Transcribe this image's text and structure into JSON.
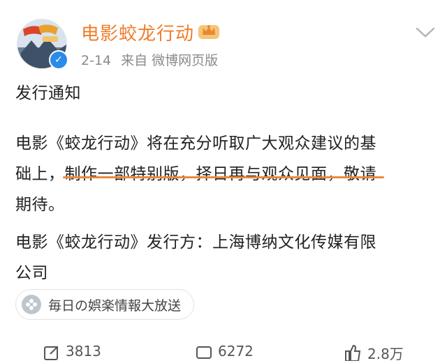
{
  "post": {
    "author": "电影蛟龙行动",
    "date": "2-14",
    "source": "来自 微博网页版",
    "title": "发行通知",
    "body_line1": "电影《蛟龙行动》将在充分听取广大观众建议的基",
    "body_line2": "础上，制作一部特别版，择日再与观众见面，敬请",
    "body_line3": "期待。",
    "publisher_line1": "电影《蛟龙行动》发行方：上海博纳文化传媒有限",
    "publisher_line2": "公司"
  },
  "topic": {
    "label": "毎日の娯楽情報大放送",
    "icon": "flower-icon"
  },
  "actions": {
    "repost": {
      "icon": "repost-icon",
      "count": "3813"
    },
    "comment": {
      "icon": "comment-icon",
      "count": "6272"
    },
    "like": {
      "icon": "thumbs-up-icon",
      "count": "2.8万"
    }
  },
  "colors": {
    "accent": "#f07c2a",
    "underline": "#e98a3e",
    "verified": "#2b8be8"
  }
}
